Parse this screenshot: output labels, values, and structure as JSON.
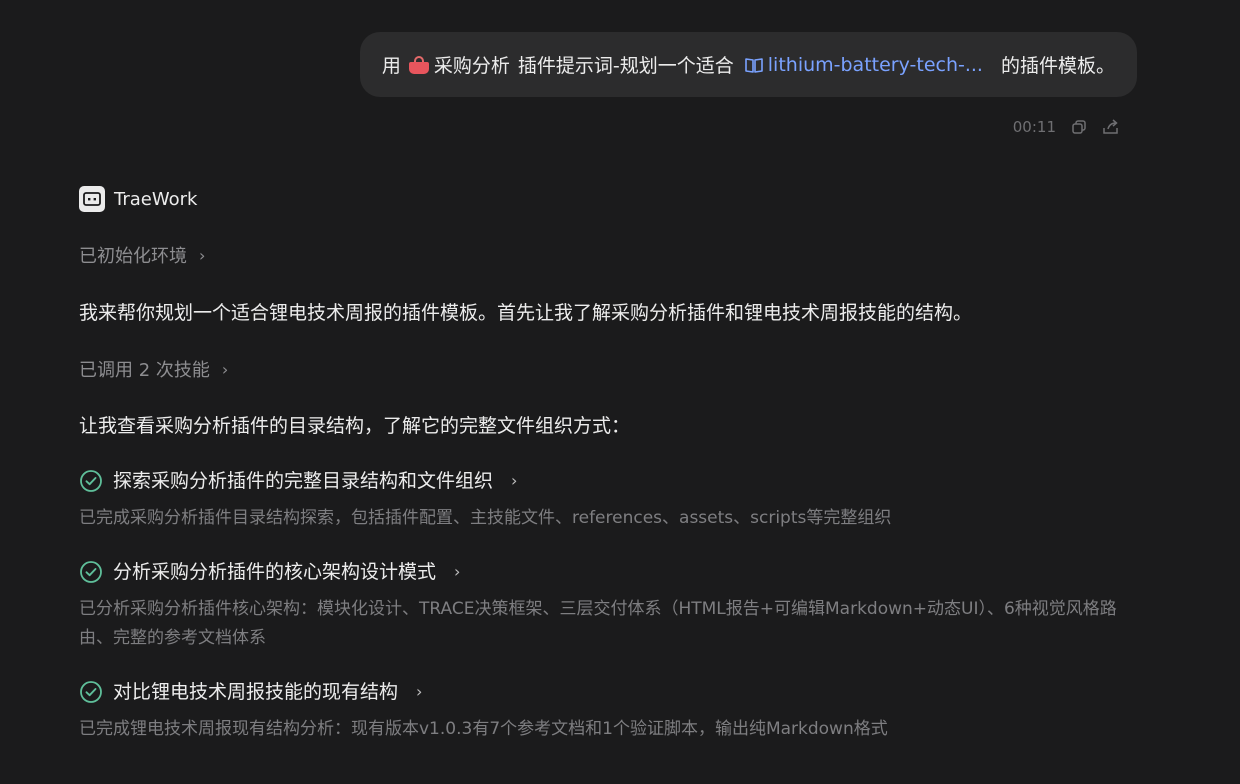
{
  "user_message": {
    "prefix": "用",
    "plugin_name": "采购分析",
    "middle": "插件提示词-规划一个适合",
    "skill_link": "lithium-battery-tech-...",
    "suffix": "的插件模板。",
    "time": "00:11"
  },
  "assistant": {
    "name": "TraeWork",
    "init_status": "已初始化环境",
    "intro": "我来帮你规划一个适合锂电技术周报的插件模板。首先让我了解采购分析插件和锂电技术周报技能的结构。",
    "skill_status": "已调用 2 次技能",
    "lead": "让我查看采购分析插件的目录结构，了解它的完整文件组织方式：",
    "tasks": [
      {
        "title": "探索采购分析插件的完整目录结构和文件组织",
        "desc": "已完成采购分析插件目录结构探索，包括插件配置、主技能文件、references、assets、scripts等完整组织"
      },
      {
        "title": "分析采购分析插件的核心架构设计模式",
        "desc": "已分析采购分析插件核心架构：模块化设计、TRACE决策框架、三层交付体系（HTML报告+可编辑Markdown+动态UI）、6种视觉风格路由、完整的参考文档体系"
      },
      {
        "title": "对比锂电技术周报技能的现有结构",
        "desc": "已完成锂电技术周报现有结构分析：现有版本v1.0.3有7个参考文档和1个验证脚本，输出纯Markdown格式"
      }
    ]
  },
  "icons": {
    "basket": "basket-icon",
    "book": "book-icon",
    "copy": "copy-icon",
    "share": "share-icon",
    "logo": "traework-logo-icon",
    "check": "check-circle-icon",
    "chevron": "chevron-right-icon"
  },
  "colors": {
    "background": "#1b1b1c",
    "bubble": "#2c2c2d",
    "link": "#7aa2ff",
    "check": "#5fbf9a"
  }
}
